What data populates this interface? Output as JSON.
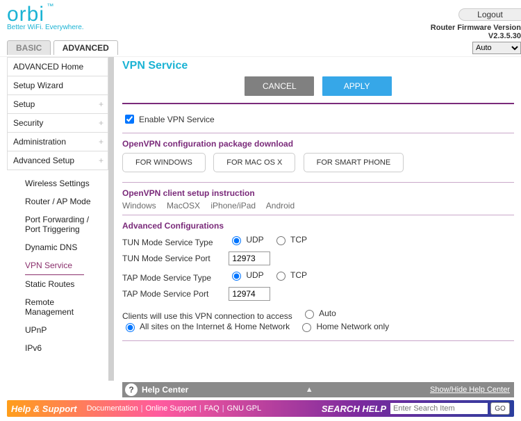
{
  "brand": {
    "name": "orbi",
    "tagline": "Better WiFi. Everywhere."
  },
  "logout_label": "Logout",
  "firmware": {
    "label": "Router Firmware Version",
    "value": "V2.3.5.30"
  },
  "tabs": {
    "basic": "BASIC",
    "advanced": "ADVANCED"
  },
  "lang_select": "Auto",
  "sidebar": {
    "items": [
      {
        "label": "ADVANCED Home",
        "expandable": false
      },
      {
        "label": "Setup Wizard",
        "expandable": false
      },
      {
        "label": "Setup",
        "expandable": true
      },
      {
        "label": "Security",
        "expandable": true
      },
      {
        "label": "Administration",
        "expandable": true
      },
      {
        "label": "Advanced Setup",
        "expandable": true
      }
    ],
    "subitems": [
      "Wireless Settings",
      "Router / AP Mode",
      "Port Forwarding / Port Triggering",
      "Dynamic DNS",
      "VPN Service",
      "Static Routes",
      "Remote Management",
      "UPnP",
      "IPv6"
    ],
    "selected_sub": "VPN Service"
  },
  "page": {
    "title": "VPN Service",
    "cancel": "CANCEL",
    "apply": "APPLY",
    "enable_label": "Enable VPN Service",
    "enable_checked": true,
    "download_head": "OpenVPN configuration package download",
    "download_buttons": [
      "FOR WINDOWS",
      "FOR MAC OS X",
      "FOR SMART PHONE"
    ],
    "instr_head": "OpenVPN client setup instruction",
    "instr_links": [
      "Windows",
      "MacOSX",
      "iPhone/iPad",
      "Android"
    ],
    "adv_head": "Advanced Configurations",
    "cfg": {
      "tun_type_label": "TUN Mode Service Type",
      "tun_type_udp": "UDP",
      "tun_type_tcp": "TCP",
      "tun_type_selected": "UDP",
      "tun_port_label": "TUN Mode Service Port",
      "tun_port_value": "12973",
      "tap_type_label": "TAP Mode Service Type",
      "tap_type_udp": "UDP",
      "tap_type_tcp": "TCP",
      "tap_type_selected": "UDP",
      "tap_port_label": "TAP Mode Service Port",
      "tap_port_value": "12974",
      "access_label": "Clients will use this VPN connection to access",
      "access_options": [
        "Auto",
        "All sites on the Internet & Home Network",
        "Home Network only"
      ],
      "access_selected": "All sites on the Internet & Home Network"
    }
  },
  "helpcenter": {
    "title": "Help Center",
    "toggle": "Show/Hide Help Center"
  },
  "support": {
    "title": "Help & Support",
    "links": [
      "Documentation",
      "Online Support",
      "FAQ",
      "GNU GPL"
    ],
    "search_label": "SEARCH HELP",
    "search_placeholder": "Enter Search Item",
    "go": "GO"
  }
}
